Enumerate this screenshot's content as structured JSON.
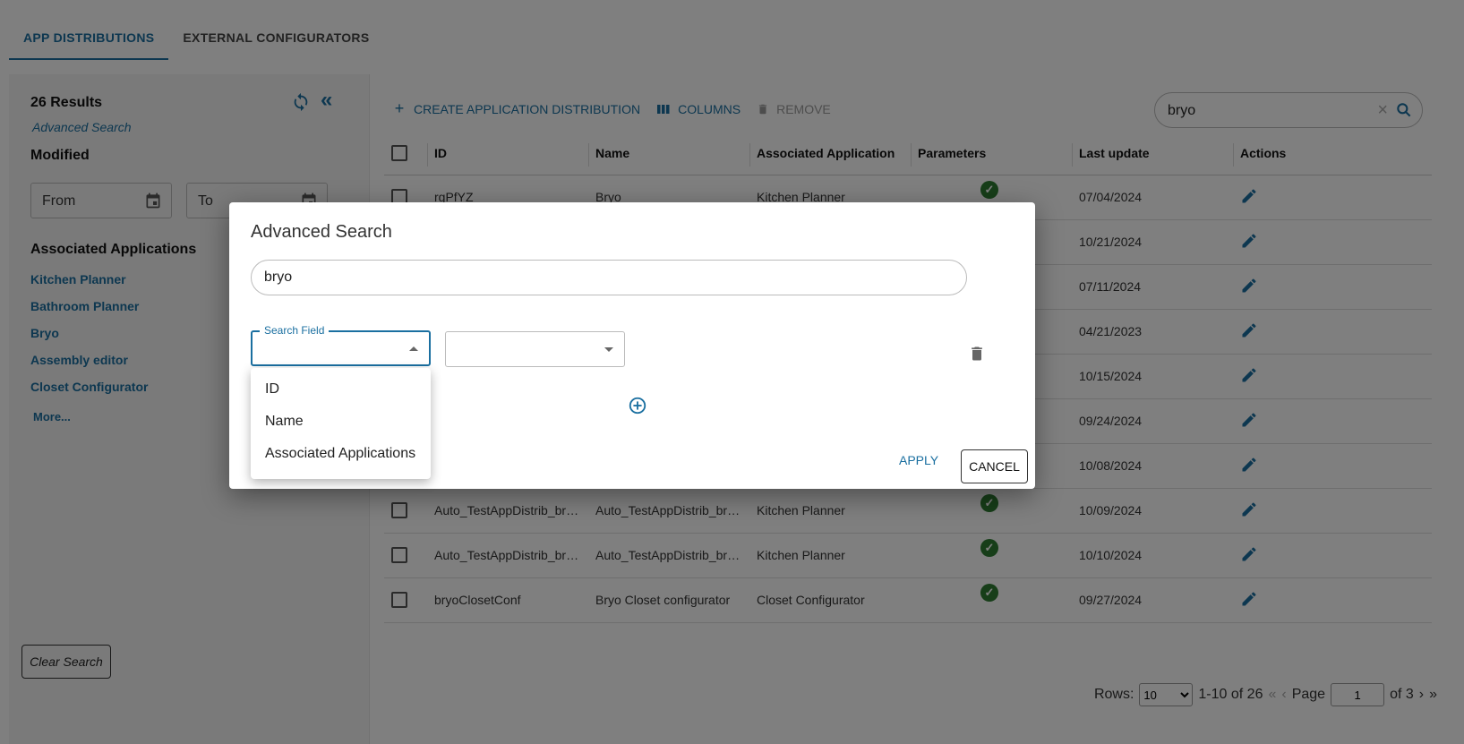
{
  "tabs": [
    {
      "label": "APP DISTRIBUTIONS",
      "active": true
    },
    {
      "label": "EXTERNAL CONFIGURATORS",
      "active": false
    }
  ],
  "sidebar": {
    "results": "26 Results",
    "advanced_search_link": "Advanced Search",
    "modified_title": "Modified",
    "from_label": "From",
    "to_label": "To",
    "associated_title": "Associated Applications",
    "associated_items": [
      "Kitchen Planner",
      "Bathroom Planner",
      "Bryo",
      "Assembly editor",
      "Closet Configurator"
    ],
    "more_label": "More...",
    "clear_search_label": "Clear Search"
  },
  "toolbar": {
    "create_label": "CREATE APPLICATION DISTRIBUTION",
    "columns_label": "COLUMNS",
    "remove_label": "REMOVE",
    "search_value": "bryo"
  },
  "table": {
    "columns": [
      "ID",
      "Name",
      "Associated Application",
      "Parameters",
      "Last update",
      "Actions"
    ],
    "rows": [
      {
        "id": "rgPfYZ",
        "name": "Bryo",
        "app": "Kitchen Planner",
        "params": true,
        "updated": "07/04/2024"
      },
      {
        "id": "",
        "name": "",
        "app": "",
        "params": false,
        "updated": "10/21/2024"
      },
      {
        "id": "",
        "name": "",
        "app": "",
        "params": false,
        "updated": "07/11/2024"
      },
      {
        "id": "",
        "name": "",
        "app": "",
        "params": false,
        "updated": "04/21/2023"
      },
      {
        "id": "",
        "name": "",
        "app": "",
        "params": false,
        "updated": "10/15/2024"
      },
      {
        "id": "",
        "name": "",
        "app": "",
        "params": false,
        "updated": "09/24/2024"
      },
      {
        "id": "",
        "name": "",
        "app": "",
        "params": false,
        "updated": "10/08/2024"
      },
      {
        "id": "Auto_TestAppDistrib_bryoC...",
        "name": "Auto_TestAppDistrib_bryoC...",
        "app": "Kitchen Planner",
        "params": true,
        "updated": "10/09/2024"
      },
      {
        "id": "Auto_TestAppDistrib_bryoC...",
        "name": "Auto_TestAppDistrib_bryoC...",
        "app": "Kitchen Planner",
        "params": true,
        "updated": "10/10/2024"
      },
      {
        "id": "bryoClosetConf",
        "name": "Bryo Closet configurator",
        "app": "Closet Configurator",
        "params": true,
        "updated": "09/27/2024"
      }
    ]
  },
  "pager": {
    "rows_label": "Rows:",
    "rows_value": "10",
    "range": "1-10 of 26",
    "page_label": "Page",
    "page_value": "1",
    "of_pages": "of 3"
  },
  "dialog": {
    "title": "Advanced Search",
    "query_value": "bryo",
    "search_field_label": "Search Field",
    "options": [
      "ID",
      "Name",
      "Associated Applications"
    ],
    "apply_label": "APPLY",
    "cancel_label": "CANCEL"
  },
  "colors": {
    "accent": "#1a6fa0",
    "success": "#2e7d32",
    "backdrop": "rgba(0,0,0,0.5)"
  }
}
